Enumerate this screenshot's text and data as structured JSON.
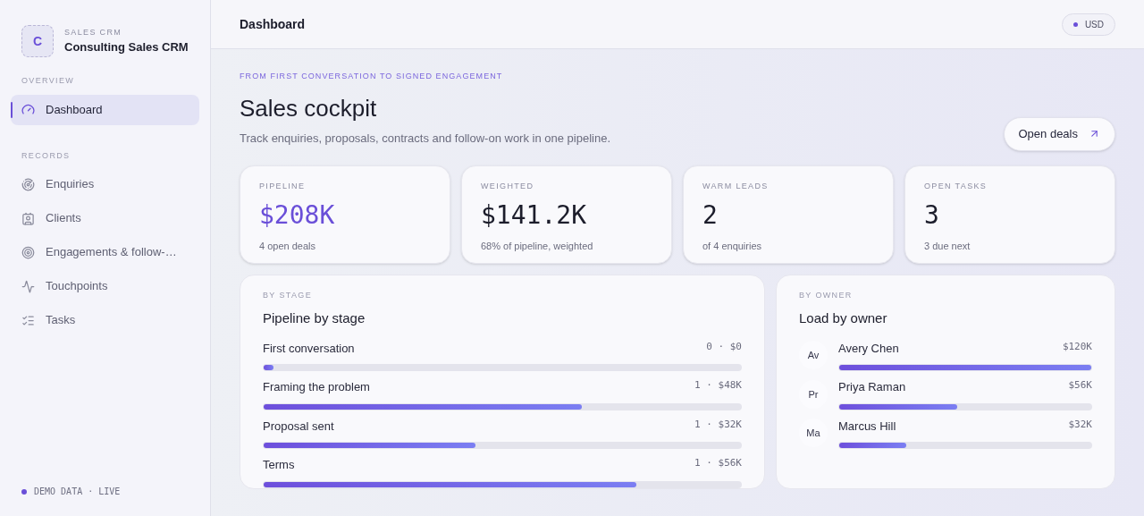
{
  "sidebar": {
    "logo_letter": "C",
    "eyebrow": "SALES CRM",
    "app_name": "Consulting Sales CRM",
    "sections": [
      {
        "title": "OVERVIEW",
        "items": [
          {
            "label": "Dashboard",
            "selected": true
          }
        ]
      },
      {
        "title": "RECORDS",
        "items": [
          {
            "label": "Enquiries",
            "selected": false
          },
          {
            "label": "Clients",
            "selected": false
          },
          {
            "label": "Engagements & follow-…",
            "selected": false
          },
          {
            "label": "Touchpoints",
            "selected": false
          },
          {
            "label": "Tasks",
            "selected": false
          }
        ]
      }
    ],
    "footer": "DEMO DATA · LIVE"
  },
  "header": {
    "title": "Dashboard",
    "currency": "USD"
  },
  "hero": {
    "eyebrow": "FROM FIRST CONVERSATION TO SIGNED ENGAGEMENT",
    "title": "Sales cockpit",
    "subtitle": "Track enquiries, proposals, contracts and follow-on work in one pipeline.",
    "action": "Open deals"
  },
  "stats": [
    {
      "label": "PIPELINE",
      "value": "$208K",
      "note": "4 open deals",
      "accent": true
    },
    {
      "label": "WEIGHTED",
      "value": "$141.2K",
      "note": "68% of pipeline, weighted",
      "accent": false
    },
    {
      "label": "WARM LEADS",
      "value": "2",
      "note": "of 4 enquiries",
      "accent": false
    },
    {
      "label": "OPEN TASKS",
      "value": "3",
      "note": "3 due next",
      "accent": false
    }
  ],
  "by_stage": {
    "eyebrow": "BY STAGE",
    "title": "Pipeline by stage",
    "rows": [
      {
        "name": "First conversation",
        "reading": "0 · $0",
        "level": 0.02
      },
      {
        "name": "Framing the problem",
        "reading": "1 · $48K",
        "level": 0.667
      },
      {
        "name": "Proposal sent",
        "reading": "1 · $32K",
        "level": 0.444
      },
      {
        "name": "Terms",
        "reading": "1 · $56K",
        "level": 0.78
      }
    ]
  },
  "by_owner": {
    "eyebrow": "BY OWNER",
    "title": "Load by owner",
    "rows": [
      {
        "initials": "Av",
        "name": "Avery Chen",
        "reading": "$120K",
        "level": 1
      },
      {
        "initials": "Pr",
        "name": "Priya Raman",
        "reading": "$56K",
        "level": 0.467
      },
      {
        "initials": "Ma",
        "name": "Marcus Hill",
        "reading": "$32K",
        "level": 0.267
      }
    ]
  }
}
